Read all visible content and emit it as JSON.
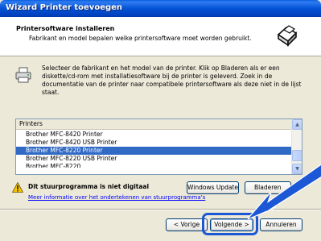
{
  "window": {
    "title": "Wizard Printer toevoegen"
  },
  "header": {
    "title": "Printersoftware installeren",
    "subtitle": "Fabrikant en model bepalen welke printersoftware moet worden gebruikt."
  },
  "intro": {
    "text": "Selecteer de fabrikant en het model van de printer. Klik op Bladeren als er een diskette/cd-rom met installatiesoftware bij de printer is geleverd. Zoek in de documentatie van de printer naar compatibele printersoftware als deze niet in de lijst staat."
  },
  "printers": {
    "header": "Printers",
    "items": [
      {
        "label": "Brother MFC-8420 Printer",
        "selected": false
      },
      {
        "label": "Brother MFC-8420 USB Printer",
        "selected": false
      },
      {
        "label": "Brother MFC-8220 Printer",
        "selected": true
      },
      {
        "label": "Brother MFC-8220 USB Printer",
        "selected": false
      },
      {
        "label": "Brother MFC-8220",
        "selected": false
      }
    ]
  },
  "warning": {
    "text": "Dit stuurprogramma is niet digitaal",
    "link": "Meer informatie over het ondertekenen van stuurprogramma's"
  },
  "buttons": {
    "windows_update": "Windows Update",
    "bladeren": "Bladeren",
    "vorige": "< Vorige",
    "volgende": "Volgende >",
    "annuleren": "Annuleren"
  },
  "colors": {
    "accent": "#316ac5",
    "annotation": "#1c57d6"
  },
  "icons": {
    "header": "printer-cd-icon",
    "intro": "printer-icon",
    "warning": "warning-icon"
  }
}
